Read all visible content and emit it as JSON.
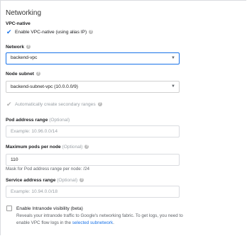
{
  "section": {
    "title": "Networking",
    "vpc_native_label": "VPC-native"
  },
  "vpc": {
    "checkbox_label": "Enable VPC-native (using alias IP)",
    "checked": true
  },
  "network": {
    "label": "Network",
    "value": "backend-vpc"
  },
  "subnet": {
    "label": "Node subnet",
    "value": "backend-subnet-vpc (10.0.0.0/9)"
  },
  "secondary": {
    "label": "Automatically create secondary ranges",
    "checked": true,
    "disabled": true
  },
  "pod_range": {
    "label": "Pod address range",
    "optional": "(Optional)",
    "placeholder": "Example: 10.96.0.0/14"
  },
  "max_pods": {
    "label": "Maximum pods per node",
    "optional": "(Optional)",
    "value": "110",
    "hint": "Mask for Pod address range per node: /24"
  },
  "service_range": {
    "label": "Service address range",
    "optional": "(Optional)",
    "placeholder": "Example: 10.94.0.0/18"
  },
  "intranode": {
    "label": "Enable Intranode visibility (beta)",
    "checked": false,
    "desc_line1": "Reveals your intranode traffic to Google's networking fabric. To get logs, you need to",
    "desc_line2_prefix": "enable VPC flow logs in the",
    "desc_link": "selected subnetwork",
    "desc_suffix": "."
  },
  "icons": {
    "help": "help-icon",
    "dropdown": "dropdown-arrow-icon",
    "check": "checkmark-icon"
  },
  "colors": {
    "accent": "#1a73e8",
    "border": "#dadce0",
    "muted": "#9aa0a6"
  }
}
